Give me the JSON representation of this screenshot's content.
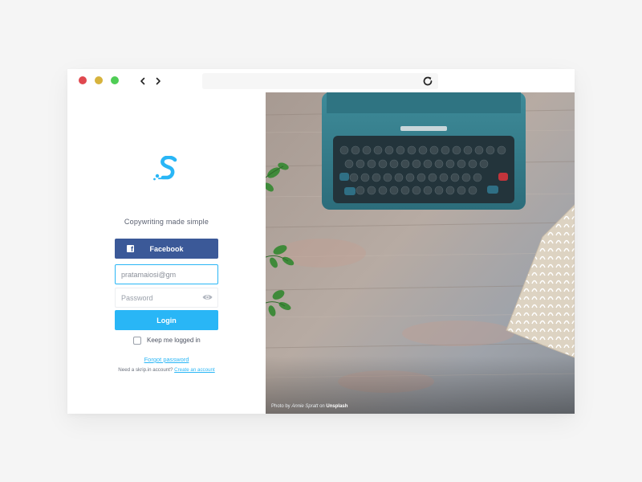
{
  "browser": {
    "traffic_lights": [
      "close",
      "minimize",
      "maximize"
    ],
    "colors": {
      "close": "#e0484f",
      "minimize": "#d7b33d",
      "maximize": "#4fcd55"
    },
    "address": ""
  },
  "login": {
    "brand_colors": {
      "primary": "#29b6f6",
      "facebook": "#3b5998"
    },
    "tagline": "Copywriting made simple",
    "facebook_label": "Facebook",
    "email_value": "pratamaiosi@gm",
    "email_placeholder": "",
    "password_placeholder": "Password",
    "login_label": "Login",
    "keep_logged_in_label": "Keep me logged in",
    "keep_logged_in_checked": false,
    "forgot_label": "Forgot password",
    "signup_prompt": "Need a skrip.in account?",
    "signup_link": "Create an account"
  },
  "photo": {
    "credit_prefix": "Photo by",
    "credit_author": "Annie Spratt",
    "credit_mid": "on",
    "credit_source": "Unsplash"
  }
}
